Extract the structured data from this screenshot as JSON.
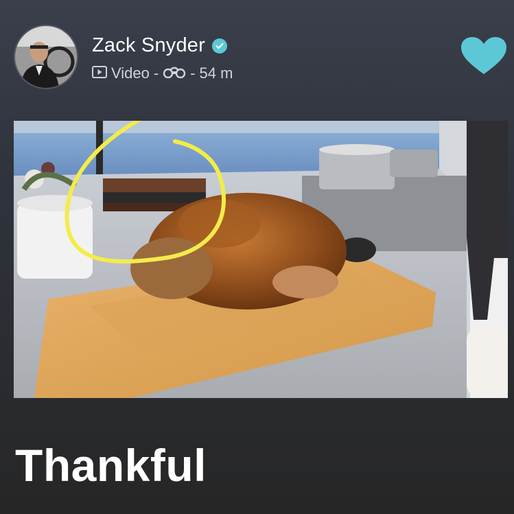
{
  "post": {
    "author": {
      "name": "Zack Snyder",
      "verified": true
    },
    "meta": {
      "type_label": "Video",
      "separator": "-",
      "time": "54 m",
      "type_icon": "play-icon",
      "views_icon": "binoculars-icon"
    },
    "like": {
      "icon": "heart-icon",
      "color": "#5cc8d6",
      "liked": true
    },
    "media": {
      "kind": "video-thumbnail",
      "annotation": "yellow-circle"
    },
    "caption": "Thankful"
  },
  "colors": {
    "accent": "#5cc8d6",
    "annotation": "#f3ec4a",
    "text": "#ffffff",
    "meta_text": "#cfd3da"
  }
}
